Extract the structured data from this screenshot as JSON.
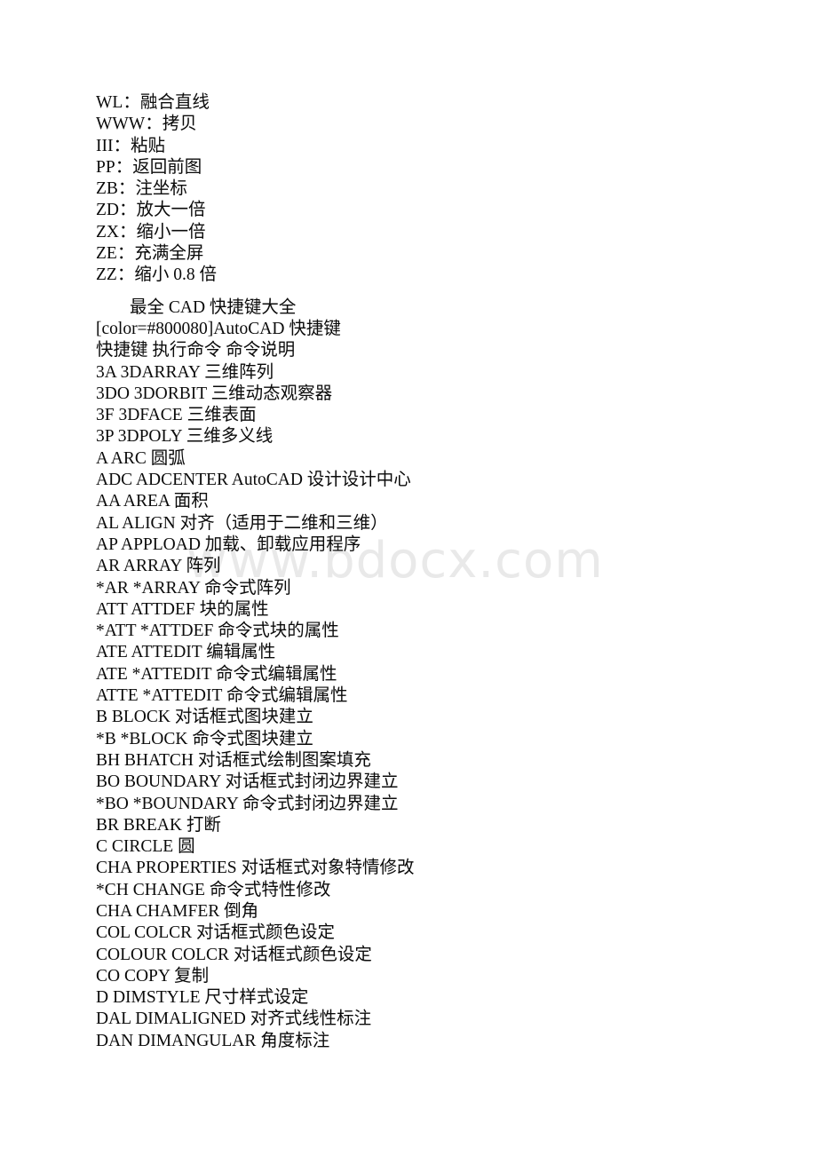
{
  "page": {
    "background_color": "#ffffff",
    "text_color": "#0a0a0a"
  },
  "watermark": {
    "text": "www.bdocx.com",
    "color": "#e9e9e9"
  },
  "document": {
    "blocks": [
      {
        "name": "shortcut-abbrev-list",
        "lines": [
          "WL：融合直线",
          "WWW：拷贝",
          "III：粘贴",
          "PP：返回前图",
          "ZB：注坐标",
          "ZD：放大一倍",
          "ZX：缩小一倍",
          "ZE：充满全屏",
          "ZZ：缩小 0.8 倍"
        ]
      },
      {
        "name": "cad-shortcut-title-block",
        "lines": [
          "最全 CAD 快捷键大全",
          "[color=#800080]AutoCAD 快捷键",
          "快捷键 执行命令 命令说明"
        ]
      },
      {
        "name": "cad-command-list",
        "lines": [
          "3A 3DARRAY 三维阵列",
          "3DO 3DORBIT 三维动态观察器",
          "3F 3DFACE 三维表面",
          "3P 3DPOLY 三维多义线",
          "A ARC 圆弧",
          "ADC ADCENTER AutoCAD 设计设计中心",
          "AA AREA 面积",
          "AL ALIGN 对齐（适用于二维和三维）",
          "AP APPLOAD 加载、卸载应用程序",
          "AR ARRAY 阵列",
          "*AR *ARRAY 命令式阵列",
          "ATT ATTDEF 块的属性",
          "*ATT *ATTDEF 命令式块的属性",
          "ATE ATTEDIT 编辑属性",
          "ATE *ATTEDIT 命令式编辑属性",
          "ATTE *ATTEDIT 命令式编辑属性",
          "B BLOCK 对话框式图块建立",
          "*B *BLOCK 命令式图块建立",
          "BH BHATCH 对话框式绘制图案填充",
          "BO BOUNDARY 对话框式封闭边界建立",
          "*BO *BOUNDARY 命令式封闭边界建立",
          "BR BREAK 打断",
          "C CIRCLE 圆",
          "CHA PROPERTIES 对话框式对象特情修改",
          "*CH CHANGE 命令式特性修改",
          "CHA CHAMFER 倒角",
          "COL COLCR 对话框式颜色设定",
          "COLOUR COLCR 对话框式颜色设定",
          "CO COPY 复制",
          "D DIMSTYLE 尺寸样式设定",
          "DAL DIMALIGNED 对齐式线性标注",
          "DAN DIMANGULAR 角度标注"
        ]
      }
    ]
  }
}
